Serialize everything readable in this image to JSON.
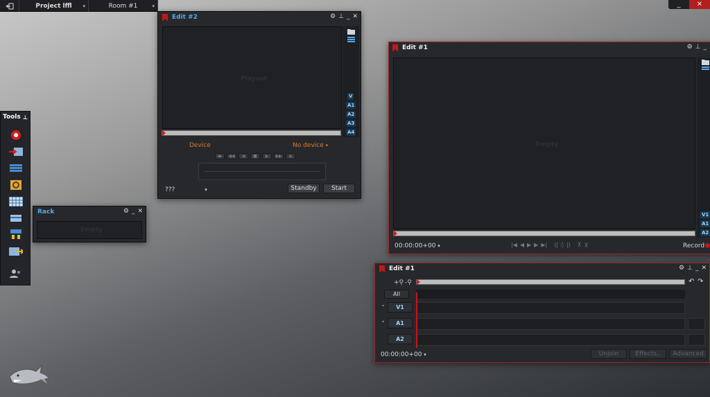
{
  "topbar": {
    "exit_icon": "exit-icon",
    "project_label": "Project lffl",
    "room_label": "Room #1"
  },
  "window_controls": {
    "minimize": "_",
    "close": "✕"
  },
  "edit2": {
    "title": "Edit #2",
    "placeholder": "Playout",
    "tracks": [
      "V",
      "A1",
      "A2",
      "A3",
      "A4"
    ],
    "device_label": "Device",
    "device_value": "No device",
    "source_value": "???",
    "standby_label": "Standby",
    "start_label": "Start"
  },
  "rack": {
    "title": "Rack",
    "placeholder": "Empty"
  },
  "tools": {
    "title": "Tools"
  },
  "edit1_viewer": {
    "title": "Edit #1",
    "placeholder": "Empty",
    "tracks": [
      "V1",
      "A1",
      "A2"
    ],
    "timecode": "00:00:00+00",
    "record_label": "Record"
  },
  "edit1_timeline": {
    "title": "Edit #1",
    "all_label": "All",
    "tracks": [
      "V1",
      "A1",
      "A2"
    ],
    "timecode": "00:00:00+00",
    "unjoin_label": "Unjoin",
    "effects_label": "Effects..",
    "advanced_label": "Advanced"
  },
  "colors": {
    "accent_red": "#c8151b",
    "accent_blue": "#5aa9e6",
    "device_orange": "#e07a2a"
  }
}
